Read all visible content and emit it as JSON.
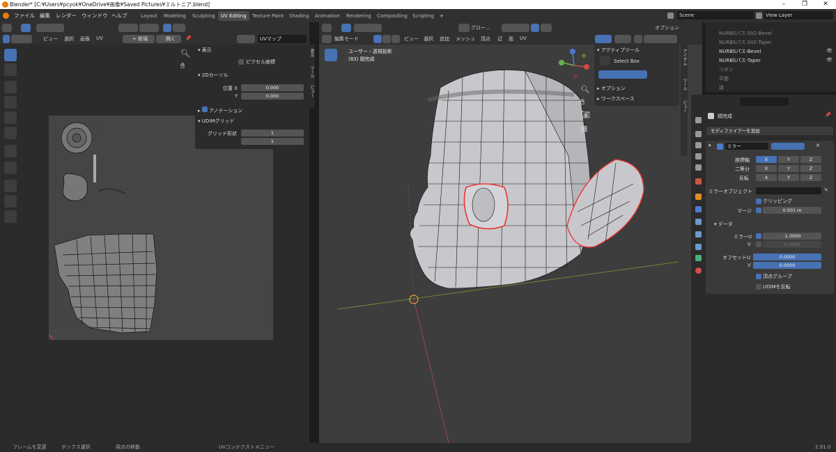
{
  "title_bar": {
    "text": "Blender* [C:¥Users¥pcyok¥OneDrive¥画像¥Saved Pictures¥ミルトニア.blend]"
  },
  "menu": [
    "ファイル",
    "編集",
    "レンダー",
    "ウィンドウ",
    "ヘルプ"
  ],
  "workspaces": [
    "Layout",
    "Modeling",
    "Sculpting",
    "UV Editing",
    "Texture Paint",
    "Shading",
    "Animation",
    "Rendering",
    "Compositing",
    "Scripting"
  ],
  "active_workspace": "UV Editing",
  "scene": "Scene",
  "view_layer": "View Layer",
  "uv_editor": {
    "menus": [
      "ビュー",
      "選択",
      "画像",
      "UV"
    ],
    "new": "+ 新規",
    "open": "開く",
    "uv_map": "UVマップ",
    "sidebar": {
      "display": "表示",
      "pixel_coords": "ピクセル座標",
      "cursor2d": "2Dカーソル",
      "pos_x_label": "位置 X",
      "pos_x": "0.000",
      "pos_y_label": "Y",
      "pos_y": "0.000",
      "annotation": "アノテーション",
      "udim": "UDIMグリッド",
      "grid_shape": "グリッド形状",
      "grid_a": "1",
      "grid_b": "1"
    },
    "tabs": [
      "表示",
      "ツール",
      "ビュー"
    ]
  },
  "viewport": {
    "mode": "編集モード",
    "menus": [
      "ビュー",
      "選択",
      "追加",
      "メッシュ",
      "頂点",
      "辺",
      "面",
      "UV"
    ],
    "orientation": "グロー...",
    "options": "オプション",
    "view_name": "ユーザー・透視投影",
    "object_name": "(83) 顔完成",
    "active_tool": "アクティブツール",
    "select_box": "Select Box",
    "options_section": "オプション",
    "workspace_section": "ワークスペース",
    "tabs": [
      "アイテム",
      "ツール",
      "ビュー"
    ]
  },
  "outliner": {
    "items": [
      "NURBSパス.002-Bevel",
      "NURBSパス.002-Taper",
      "NURBSパス-Bevel",
      "NURBSパス-Taper",
      "リボン",
      "平面",
      "球"
    ]
  },
  "properties": {
    "object": "顔完成",
    "add_modifier": "モディファイアーを追加",
    "modifier_name": "ミラー",
    "axis_label": "座標軸",
    "bisect_label": "二等分",
    "flip_label": "反転",
    "x": "X",
    "y": "Y",
    "z": "Z",
    "mirror_object": "ミラーオブジェクト",
    "clipping": "クリッピング",
    "merge_label": "マージ",
    "merge_value": "0.001 m",
    "data": "データ",
    "mirror_u_label": "ミラーU",
    "mirror_u": "-1.0000",
    "v_label": "V",
    "mirror_v": "0.0000",
    "offset_u_label": "オフセットU",
    "offset_u": "0.0000",
    "offset_v": "0.0000",
    "vertex_groups": "頂点グループ",
    "udim_flip": "UDIMを反転"
  },
  "status": {
    "a": "フレームを変更",
    "b": "ボックス選択",
    "c": "視点の移動",
    "d": "UVコンテクストメニュー",
    "version": "2.91.0"
  },
  "colors": {
    "accent": "#4772b3",
    "bg": "#1d1d1d",
    "panel": "#303030",
    "viewport": "#3d3d3d",
    "edge_sel": "#ff4d4d",
    "vertex": "#000000"
  }
}
